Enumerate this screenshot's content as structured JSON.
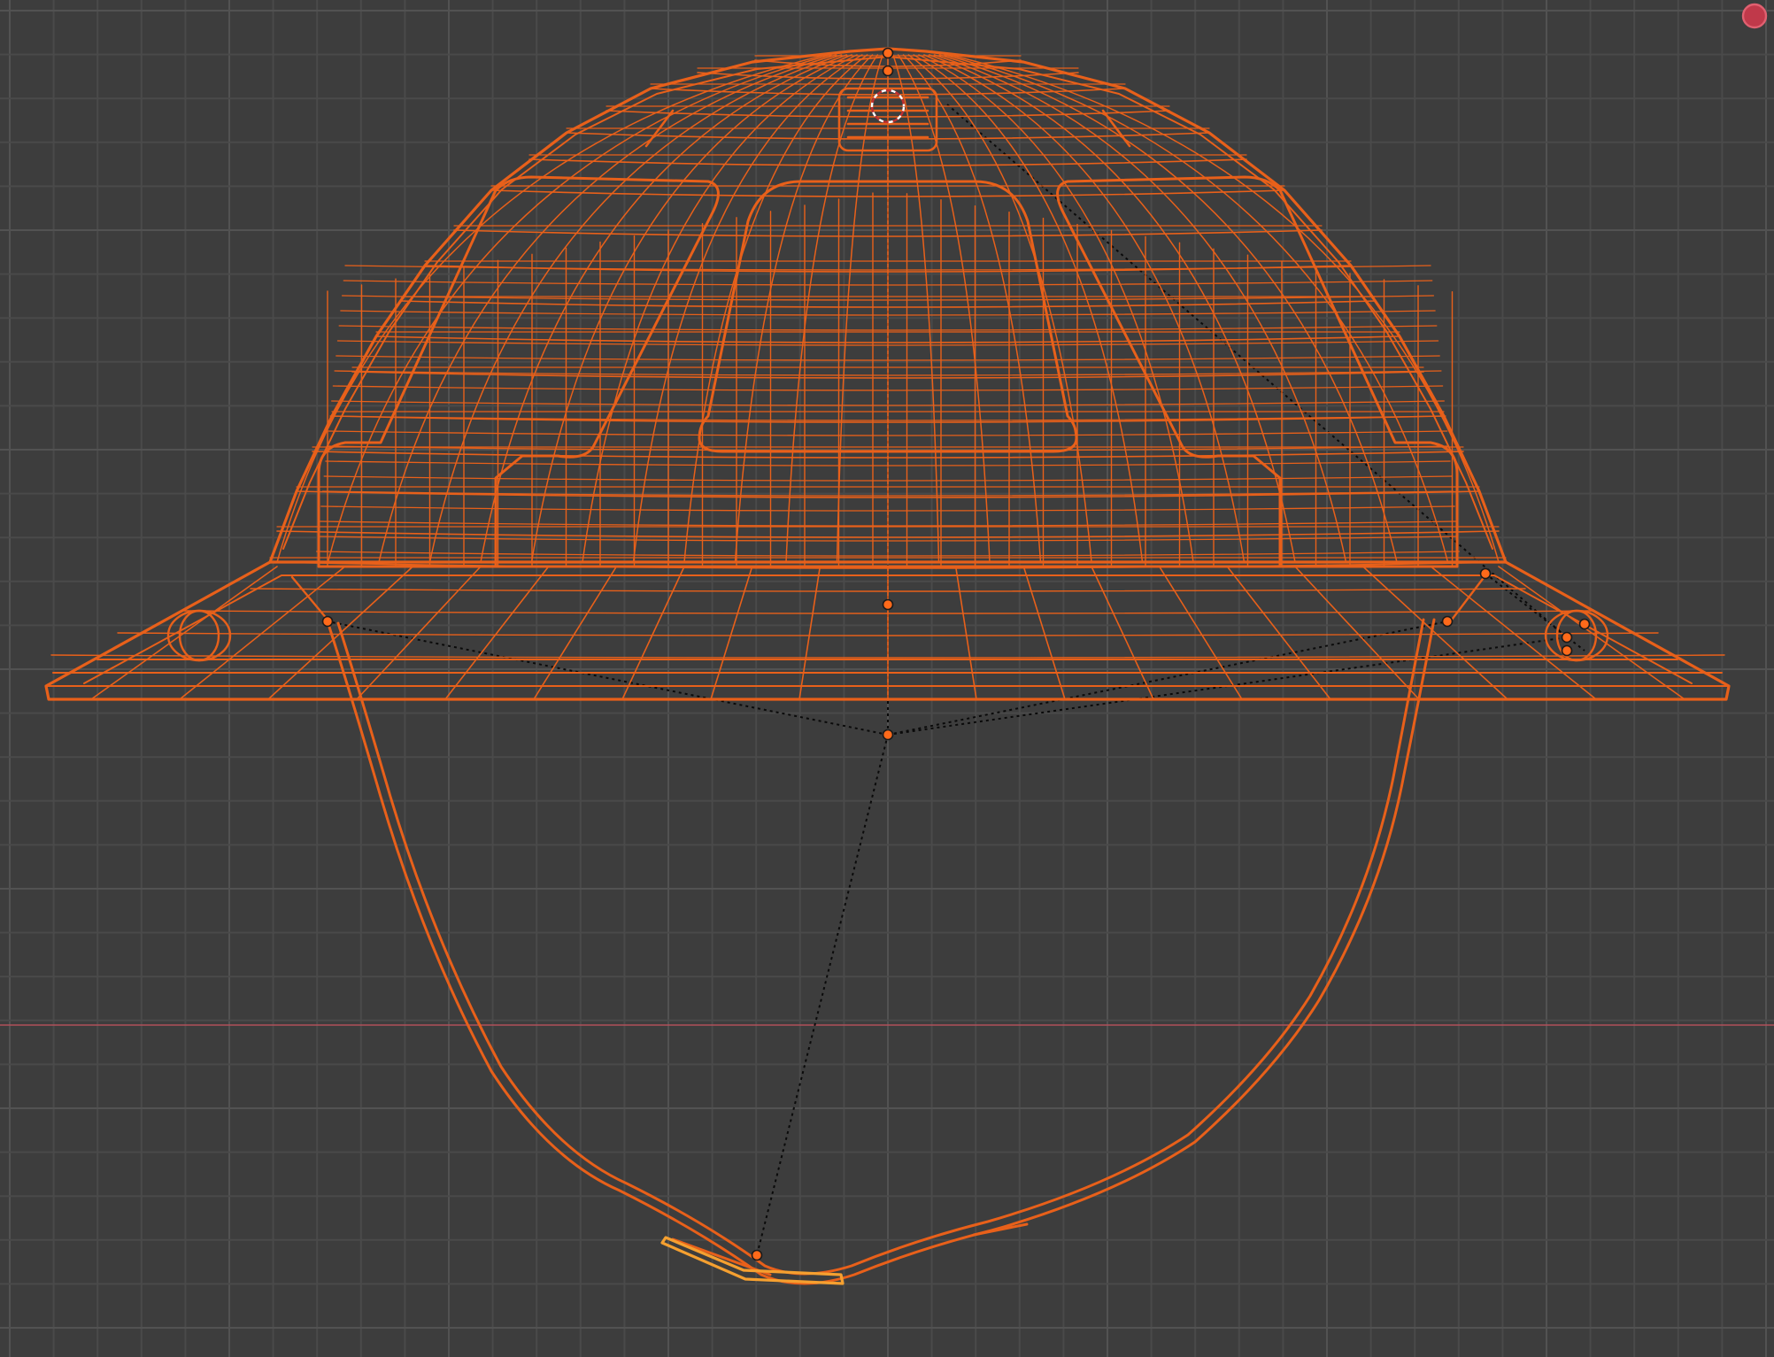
{
  "viewport": {
    "view": "front-orthographic",
    "shading": "wireframe",
    "background_color": "#3d3d3d",
    "grid_color": "#4a4a4a",
    "grid_major_color": "#525252",
    "x_axis_color": "#b0505a"
  },
  "object": {
    "type": "helmet-mesh",
    "state": "selected",
    "wire_color": "#e8601a",
    "wire_highlight_color": "#ff8a3a",
    "active_clip_color": "#f5a030"
  },
  "overlays": {
    "origin_point_color": "#ff6a1a",
    "relationship_line_color": "#0a0a0a",
    "cursor_3d": "3d-cursor-icon",
    "corner_button_color": "#c0394a",
    "corner_button_icon": "record-icon"
  }
}
